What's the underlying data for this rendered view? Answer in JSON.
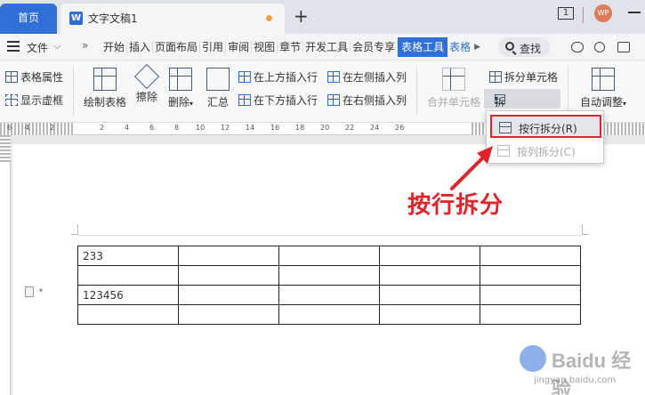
{
  "tabs": {
    "home": "首页",
    "doc_title": "文字文稿1",
    "doc_icon": "W",
    "add": "+"
  },
  "titlebar": {
    "window_count": "1",
    "avatar": "WP"
  },
  "menu": {
    "file": "文件",
    "more": "»",
    "items": [
      "开始",
      "插入",
      "页面布局",
      "引用",
      "审阅",
      "视图",
      "章节",
      "开发工具",
      "会员专享"
    ],
    "active": "表格工具",
    "partial": "表格",
    "search": "查找"
  },
  "ribbon": {
    "table_props": "表格属性",
    "show_gridlines": "显示虚框",
    "draw_table": "绘制表格",
    "erase": "擦除",
    "delete": "删除",
    "summary": "汇总",
    "insert_above": "在上方插入行",
    "insert_below": "在下方插入行",
    "insert_left": "在左侧插入列",
    "insert_right": "在右侧插入列",
    "merge_cells": "合并单元格",
    "split_cells": "拆分单元格",
    "split_table": "拆分表格",
    "auto_fit": "自动调整"
  },
  "ruler": {
    "numbers": [
      "6",
      "4",
      "2",
      "2",
      "4",
      "6",
      "8",
      "10",
      "12",
      "14",
      "16",
      "18",
      "20",
      "22",
      "24",
      "26"
    ]
  },
  "dropdown": {
    "split_by_row": "按行拆分(R)",
    "split_by_col": "按列拆分(C)"
  },
  "table": {
    "rows": [
      [
        "233",
        "",
        "",
        "",
        ""
      ],
      [
        "",
        "",
        "",
        "",
        ""
      ],
      [
        "123456",
        "",
        "",
        "",
        ""
      ],
      [
        "",
        "",
        "",
        "",
        ""
      ]
    ]
  },
  "annotation": "按行拆分",
  "watermark": {
    "brand": "Baidu 经验",
    "url": "jingyan.baidu.com"
  },
  "colors": {
    "accent": "#2f6fd6",
    "annotation": "#e0242b"
  }
}
